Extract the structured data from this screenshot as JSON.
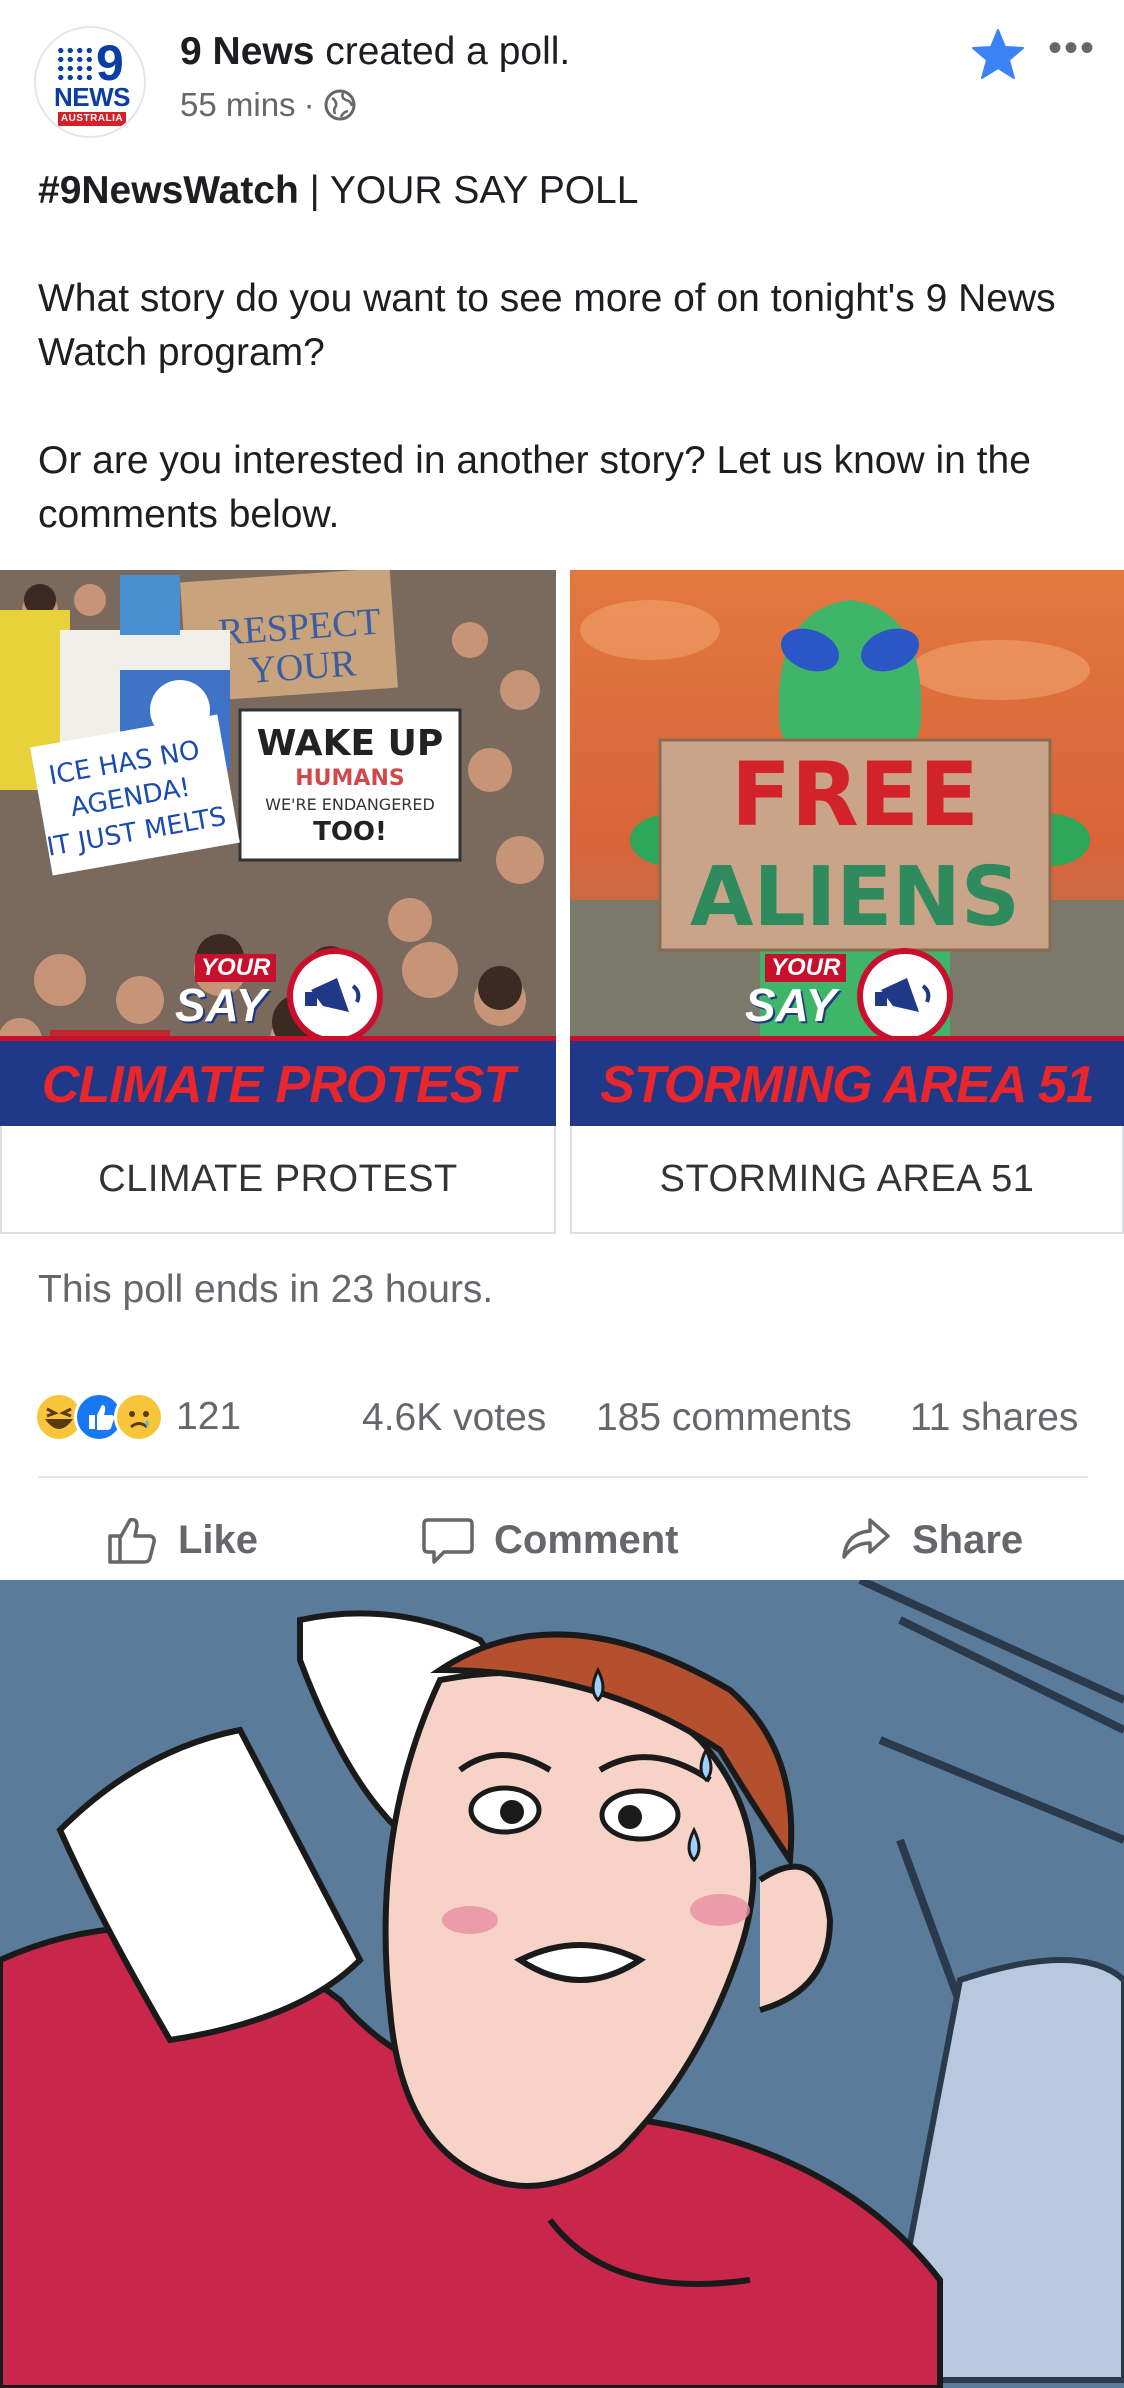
{
  "header": {
    "page_name": "9 News",
    "action_text": "created a poll.",
    "time_ago": "55 mins",
    "separator": "·",
    "logo_news": "NEWS",
    "logo_nine": "9",
    "logo_country": "AUSTRALIA",
    "more_label": "•••"
  },
  "post": {
    "hashtag": "#9NewsWatch",
    "title_rest": " | YOUR SAY POLL",
    "question": "What story do you want to see more of on tonight's 9 News Watch program?",
    "followup": "Or are you interested in another story? Let us know in the comments below."
  },
  "poll": {
    "options": [
      {
        "label": "CLIMATE PROTEST",
        "banner": "CLIMATE PROTEST",
        "your": "YOUR",
        "say": "SAY",
        "signs": [
          "RESPECT YOUR MOTHER",
          "WAKE UP HUMANS",
          "WE'RE ENDANGERED TOO!",
          "ICE HAS NO AGENDA! IT JUST MELTS"
        ]
      },
      {
        "label": "STORMING AREA 51",
        "banner": "STORMING AREA 51",
        "your": "YOUR",
        "say": "SAY",
        "signs": [
          "FREE",
          "ALIENS"
        ]
      }
    ],
    "ends_text": "This poll ends in 23 hours."
  },
  "engagement": {
    "reaction_count": "121",
    "votes": "4.6K votes",
    "comments": "185 comments",
    "shares": "11 shares"
  },
  "actions": {
    "like": "Like",
    "comment": "Comment",
    "share": "Share"
  },
  "colors": {
    "banner_blue": "#1f3887",
    "banner_red": "#e8262c",
    "brand_blue": "#0a3ea6",
    "star_blue": "#3b82f6"
  }
}
